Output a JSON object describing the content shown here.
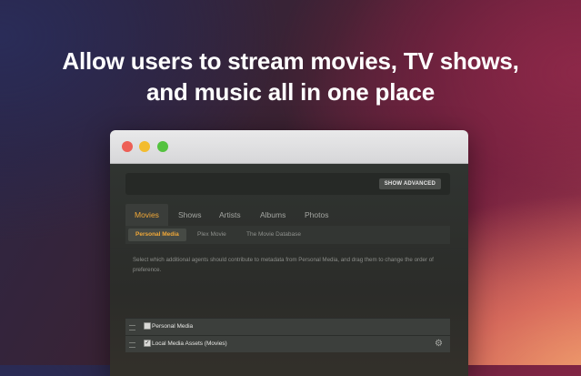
{
  "headline": {
    "line1": "Allow users to stream movies, TV shows,",
    "line2": "and music all in one place"
  },
  "window": {
    "controls": [
      "close",
      "minimize",
      "zoom"
    ],
    "show_advanced_label": "SHOW ADVANCED",
    "tabs": [
      {
        "label": "Movies",
        "active": true
      },
      {
        "label": "Shows",
        "active": false
      },
      {
        "label": "Artists",
        "active": false
      },
      {
        "label": "Albums",
        "active": false
      },
      {
        "label": "Photos",
        "active": false
      }
    ],
    "subtabs": [
      {
        "label": "Personal Media",
        "active": true
      },
      {
        "label": "Plex Movie",
        "active": false
      },
      {
        "label": "The Movie Database",
        "active": false
      }
    ],
    "description": "Select which additional agents should contribute to metadata from Personal Media, and drag them to change the order of preference.",
    "agents": [
      {
        "label": "Personal Media",
        "checked": true,
        "icon": "drag-handle-icon"
      },
      {
        "label": "Local Media Assets (Movies)",
        "checked": true,
        "icon": "drag-handle-icon",
        "settings_icon": "gear-icon"
      }
    ],
    "colors": {
      "accent": "#f0a838",
      "close": "#ed5f56",
      "minimize": "#f3bc2f",
      "zoom": "#54c23f"
    }
  }
}
